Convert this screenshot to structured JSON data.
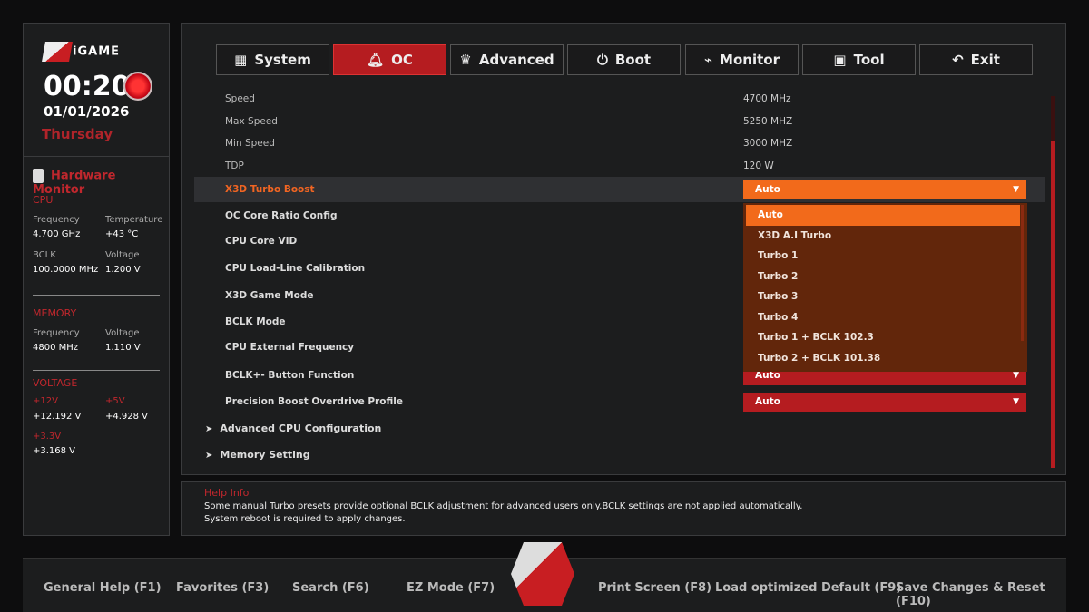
{
  "sidebar": {
    "brand": "iGAME",
    "time": "00:20",
    "date": "01/01/2026",
    "day": "Thursday",
    "hw_title": "Hardware Monitor",
    "cpu": {
      "title": "CPU",
      "freq_label": "Frequency",
      "freq": "4.700 GHz",
      "temp_label": "Temperature",
      "temp": "+43 °C",
      "bclk_label": "BCLK",
      "bclk": "100.0000 MHz",
      "volt_label": "Voltage",
      "volt": "1.200 V"
    },
    "memory": {
      "title": "MEMORY",
      "freq_label": "Frequency",
      "freq": "4800 MHz",
      "volt_label": "Voltage",
      "volt": "1.110 V"
    },
    "voltage": {
      "title": "VOLTAGE",
      "v12_label": "+12V",
      "v12": "+12.192 V",
      "v5_label": "+5V",
      "v5": "+4.928 V",
      "v33_label": "+3.3V",
      "v33": "+3.168 V"
    }
  },
  "tabs": [
    {
      "label": "System",
      "icon": "grid-icon"
    },
    {
      "label": "OC",
      "icon": "rocket-icon"
    },
    {
      "label": "Advanced",
      "icon": "crown-icon"
    },
    {
      "label": "Boot",
      "icon": "power-icon"
    },
    {
      "label": "Monitor",
      "icon": "pulse-icon"
    },
    {
      "label": "Tool",
      "icon": "toolbox-icon"
    },
    {
      "label": "Exit",
      "icon": "back-arrow-icon"
    }
  ],
  "settings": [
    {
      "name": "Speed",
      "value": "4700 MHz"
    },
    {
      "name": "Max Speed",
      "value": "5250 MHZ"
    },
    {
      "name": "Min Speed",
      "value": "3000 MHZ"
    },
    {
      "name": "TDP",
      "value": "120 W"
    },
    {
      "name": "X3D Turbo Boost",
      "value": "Auto"
    },
    {
      "name": "OC Core Ratio Config"
    },
    {
      "name": "CPU Core VID"
    },
    {
      "name": "CPU Load-Line Calibration"
    },
    {
      "name": "X3D Game Mode"
    },
    {
      "name": "BCLK Mode"
    },
    {
      "name": "CPU External Frequency"
    },
    {
      "name": "BCLK+- Button Function",
      "value": "Auto"
    },
    {
      "name": "Precision Boost Overdrive Profile",
      "value": "Auto"
    }
  ],
  "submenus": [
    "Advanced CPU Configuration",
    "Memory Setting"
  ],
  "dropdown_options": [
    "Auto",
    "X3D A.I Turbo",
    "Turbo 1",
    "Turbo 2",
    "Turbo 3",
    "Turbo 4",
    "Turbo 1 + BCLK 102.3",
    "Turbo 2 + BCLK 101.38"
  ],
  "help": {
    "title": "Help Info",
    "line1": "Some manual Turbo presets provide optional BCLK adjustment for advanced users only.BCLK settings are not applied automatically.",
    "line2": "System reboot is required to apply changes."
  },
  "footer": [
    "General Help (F1)",
    "Favorites (F3)",
    "Search (F6)",
    "EZ Mode (F7)",
    "Print Screen (F8)",
    "Load optimized Default (F9)",
    "Save Changes & Reset (F10)"
  ],
  "colors": {
    "accent_red": "#b51c20",
    "accent_orange": "#f26a1b",
    "dropdown_bg": "#62260b"
  }
}
